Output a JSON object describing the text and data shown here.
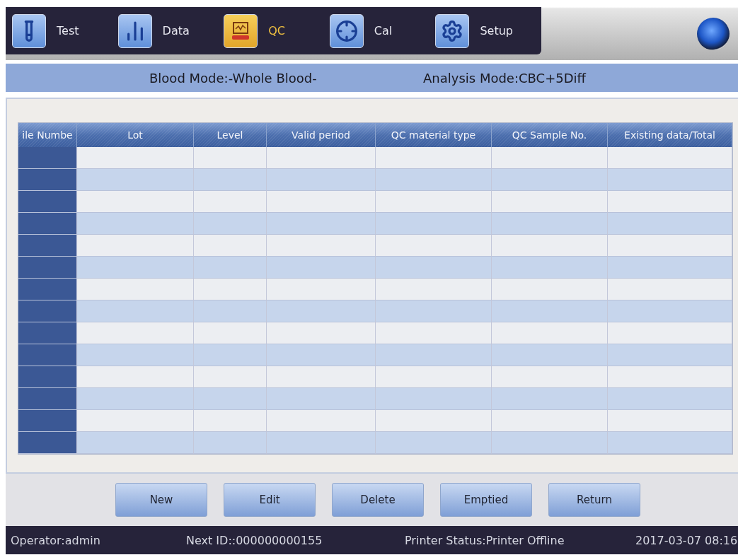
{
  "nav": {
    "tabs": [
      {
        "label": "Test",
        "kind": "tube",
        "selected": false
      },
      {
        "label": "Data",
        "kind": "chart",
        "selected": false
      },
      {
        "label": "QC",
        "kind": "monitor",
        "selected": true
      },
      {
        "label": "Cal",
        "kind": "crosshair",
        "selected": false
      },
      {
        "label": "Setup",
        "kind": "gear",
        "selected": false
      }
    ]
  },
  "mode_bar": {
    "blood_mode": "Blood Mode:-Whole Blood-",
    "analysis_mode": "Analysis Mode:CBC+5Diff"
  },
  "table": {
    "columns": [
      "ile Numbe",
      "Lot",
      "Level",
      "Valid period",
      "QC material type",
      "QC Sample No.",
      "Existing data/Total"
    ]
  },
  "buttons": [
    "New",
    "Edit",
    "Delete",
    "Emptied",
    "Return"
  ],
  "status_bar": {
    "operator": "Operator:admin",
    "next_id": "Next ID::000000000155",
    "printer": "Printer Status:Printer Offline",
    "datetime": "2017-03-07 08:16"
  }
}
